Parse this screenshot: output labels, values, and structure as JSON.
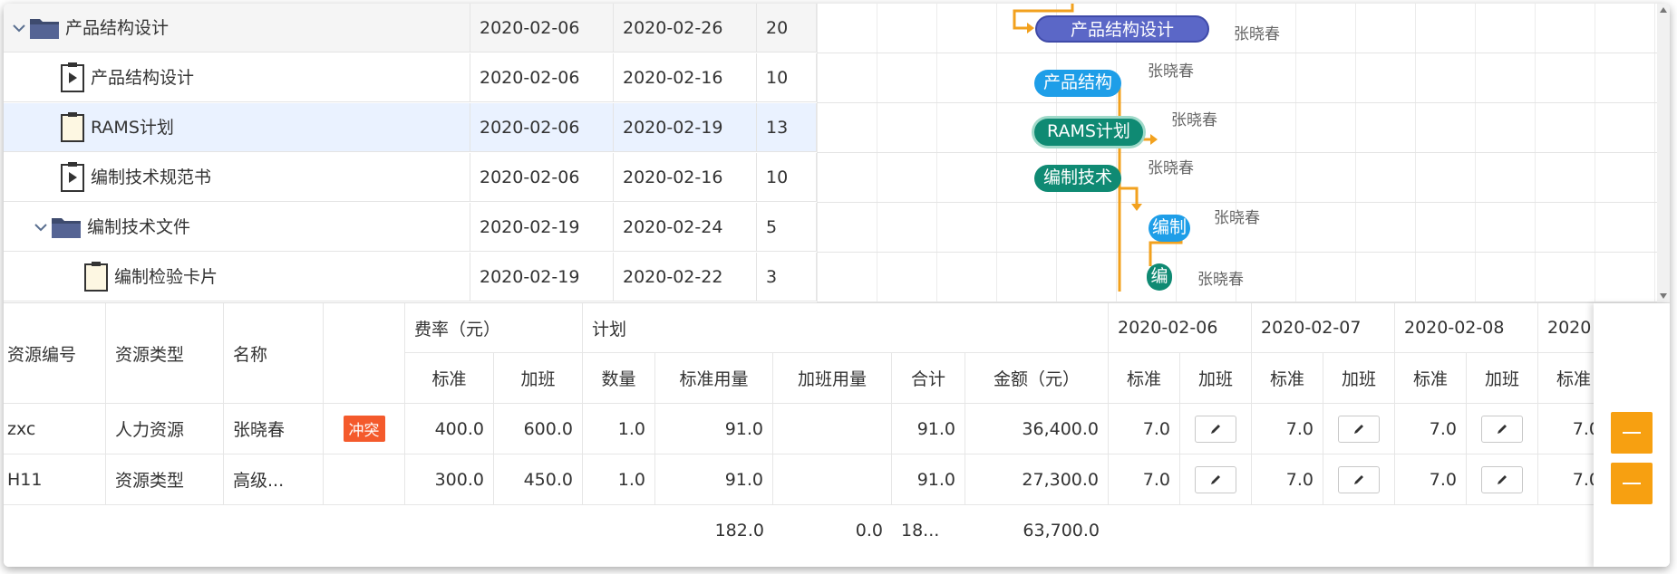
{
  "tasks": [
    {
      "name": "产品结构设计",
      "start": "2020-02-06",
      "end": "2020-02-26",
      "duration": "20",
      "kind": "summary",
      "level": 0,
      "icon": "folder-icon"
    },
    {
      "name": "产品结构设计",
      "start": "2020-02-06",
      "end": "2020-02-16",
      "duration": "10",
      "kind": "task",
      "level": 1,
      "icon": "play-document-icon"
    },
    {
      "name": "RAMS计划",
      "start": "2020-02-06",
      "end": "2020-02-19",
      "duration": "13",
      "kind": "task",
      "level": 1,
      "icon": "clipboard-icon"
    },
    {
      "name": "编制技术规范书",
      "start": "2020-02-06",
      "end": "2020-02-16",
      "duration": "10",
      "kind": "task",
      "level": 1,
      "icon": "play-document-icon"
    },
    {
      "name": "编制技术文件",
      "start": "2020-02-19",
      "end": "2020-02-24",
      "duration": "5",
      "kind": "summary",
      "level": 1,
      "icon": "folder-icon"
    },
    {
      "name": "编制检验卡片",
      "start": "2020-02-19",
      "end": "2020-02-22",
      "duration": "3",
      "kind": "task",
      "level": 2,
      "icon": "clipboard-icon"
    }
  ],
  "gantt": {
    "bars": [
      {
        "label": "产品结构设计",
        "assignee": "张晓春",
        "style": "summary"
      },
      {
        "label": "产品结构",
        "assignee": "张晓春",
        "style": "blue"
      },
      {
        "label": "RAMS计划",
        "assignee": "张晓春",
        "style": "teal"
      },
      {
        "label": "编制技术",
        "assignee": "张晓春",
        "style": "teal"
      },
      {
        "label": "编制",
        "assignee": "张晓春",
        "style": "blue"
      },
      {
        "label": "编",
        "assignee": "张晓春",
        "style": "teal"
      }
    ],
    "link_color": "#f2a11e"
  },
  "resources": {
    "headers": {
      "id": "资源编号",
      "type": "资源类型",
      "name": "名称",
      "rate": "费率（元）",
      "rate_std": "标准",
      "rate_ot": "加班",
      "plan": "计划",
      "qty": "数量",
      "std_use": "标准用量",
      "ot_use": "加班用量",
      "total": "合计",
      "amount": "金额（元）",
      "day_std": "标准",
      "day_ot": "加班"
    },
    "dates": [
      "2020-02-06",
      "2020-02-07",
      "2020-02-08",
      "2020"
    ],
    "rows": [
      {
        "id": "zxc",
        "type": "人力资源",
        "name": "张晓春",
        "badge": "冲突",
        "rate_std": "400.0",
        "rate_ot": "600.0",
        "qty": "1.0",
        "std_use": "91.0",
        "ot_use": "",
        "total": "91.0",
        "amount": "36,400.0",
        "d1": "7.0",
        "d2": "7.0",
        "d3": "7.0",
        "d4": "7.0"
      },
      {
        "id": "H11",
        "type": "资源类型",
        "name": "高级...",
        "badge": "",
        "rate_std": "300.0",
        "rate_ot": "450.0",
        "qty": "1.0",
        "std_use": "91.0",
        "ot_use": "",
        "total": "91.0",
        "amount": "27,300.0",
        "d1": "7.0",
        "d2": "7.0",
        "d3": "7.0",
        "d4": "7.0"
      }
    ],
    "footer": {
      "std_use": "182.0",
      "ot_use": "0.0",
      "total": "18...",
      "amount": "63,700.0"
    }
  },
  "colors": {
    "accent_orange": "#f7a011",
    "conflict_red": "#f45a2c",
    "summary_bar": "#5b67c7",
    "task_blue": "#1e9ee8",
    "task_teal": "#0f8a73"
  }
}
